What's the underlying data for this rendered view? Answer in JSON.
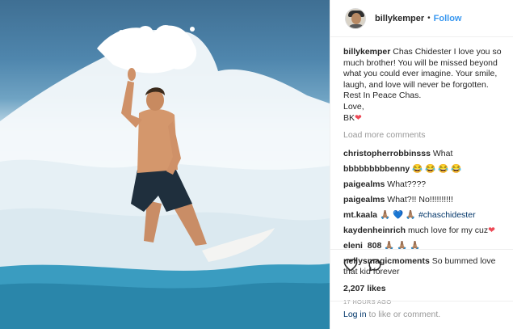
{
  "post": {
    "username": "billykemper",
    "follow_label": "Follow",
    "dot": "•"
  },
  "caption": {
    "username": "billykemper",
    "text": "Chas Chidester I love you so much brother! You will be missed beyond what you could ever imagine. Your smile, laugh, and love will never be forgotten. Rest In Peace Chas.",
    "signoff_1": "Love,",
    "signoff_2": "BK",
    "signoff_emoji": "❤"
  },
  "load_more": "Load more comments",
  "comments": [
    {
      "username": "christopherrobbinsss",
      "text": "What"
    },
    {
      "username": "bbbbbbbbbenny",
      "text": "😂 😂 😂 😂"
    },
    {
      "username": "paigealms",
      "text": "What????"
    },
    {
      "username": "paigealms",
      "text": "What?!! No!!!!!!!!!!"
    },
    {
      "username": "mt.kaala",
      "text": "🙏🏽 💙 🙏🏽",
      "tag": "#chaschidester"
    },
    {
      "username": "kaydenheinrich",
      "text": "much love for my cuz",
      "emoji": "❤"
    },
    {
      "username": "eleni_808",
      "text": "🙏🏽 🙏🏽 🙏🏽"
    },
    {
      "username": "nellysmagicmoments",
      "text": "So bummed love that kid forever"
    }
  ],
  "likes": "2,207 likes",
  "timestamp": "17 HOURS AGO",
  "footer": {
    "login_label": "Log in",
    "rest": " to like or comment."
  },
  "icons": {
    "like": "heart-outline-icon",
    "comment": "speech-bubble-icon",
    "more": "ellipsis-icon"
  },
  "colors": {
    "link": "#003569",
    "follow": "#3897f0",
    "muted": "#999999",
    "heart": "#ed4956"
  }
}
